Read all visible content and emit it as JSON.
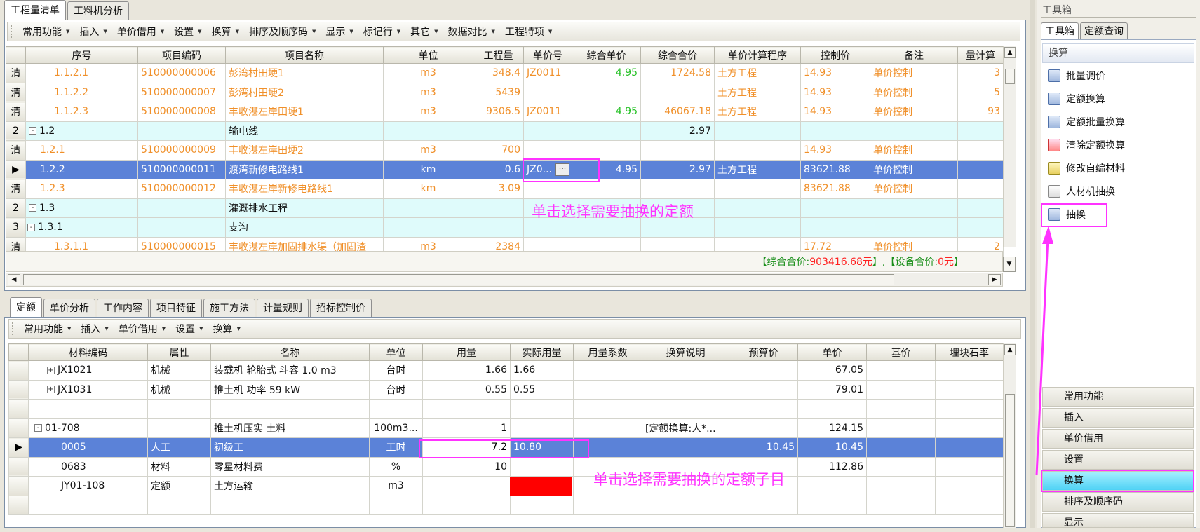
{
  "top_tabs": [
    "工程量清单",
    "工料机分析"
  ],
  "toolbar_top": [
    "常用功能",
    "插入",
    "单价借用",
    "设置",
    "换算",
    "排序及顺序码",
    "显示",
    "标记行",
    "其它",
    "数据对比",
    "工程特项"
  ],
  "upper_grid": {
    "headers": [
      "序号",
      "项目编码",
      "项目名称",
      "单位",
      "工程量",
      "单价号",
      "综合单价",
      "综合合价",
      "单价计算程序",
      "控制价",
      "备注",
      "量计算"
    ],
    "rows": [
      {
        "rh": "清",
        "seq": "1.1.2.1",
        "code": "510000000006",
        "name": "彭湾村田埂1",
        "unit": "m3",
        "qty": "348.4",
        "pno": "JZ0011",
        "up": "4.95",
        "tp": "1724.58",
        "prog": "土方工程",
        "ctrl": "14.93",
        "note": "单价控制",
        "calc": "3"
      },
      {
        "rh": "清",
        "seq": "1.1.2.2",
        "code": "510000000007",
        "name": "彭湾村田埂2",
        "unit": "m3",
        "qty": "5439",
        "pno": "",
        "up": "",
        "tp": "",
        "prog": "土方工程",
        "ctrl": "14.93",
        "note": "单价控制",
        "calc": "5"
      },
      {
        "rh": "清",
        "seq": "1.1.2.3",
        "code": "510000000008",
        "name": "丰收湛左岸田埂1",
        "unit": "m3",
        "qty": "9306.5",
        "pno": "JZ0011",
        "up": "4.95",
        "tp": "46067.18",
        "prog": "土方工程",
        "ctrl": "14.93",
        "note": "单价控制",
        "calc": "93"
      },
      {
        "rh": "2",
        "seq": "1.2",
        "code": "",
        "name": "输电线",
        "unit": "",
        "qty": "",
        "pno": "",
        "up": "",
        "tp": "2.97",
        "prog": "",
        "ctrl": "",
        "note": "",
        "calc": ""
      },
      {
        "rh": "清",
        "seq": "1.2.1",
        "code": "510000000009",
        "name": "丰收湛左岸田埂2",
        "unit": "m3",
        "qty": "700",
        "pno": "",
        "up": "",
        "tp": "",
        "prog": "",
        "ctrl": "14.93",
        "note": "单价控制",
        "calc": ""
      },
      {
        "rh": "▶",
        "seq": "1.2.2",
        "code": "510000000011",
        "name": "渡湾新修电路线1",
        "unit": "km",
        "qty": "0.6",
        "pno": "JZ0...",
        "up": "4.95",
        "tp": "2.97",
        "prog": "土方工程",
        "ctrl": "83621.88",
        "note": "单价控制",
        "calc": ""
      },
      {
        "rh": "清",
        "seq": "1.2.3",
        "code": "510000000012",
        "name": "丰收湛左岸新修电路线1",
        "unit": "km",
        "qty": "3.09",
        "pno": "",
        "up": "",
        "tp": "",
        "prog": "",
        "ctrl": "83621.88",
        "note": "单价控制",
        "calc": ""
      },
      {
        "rh": "2",
        "seq": "1.3",
        "code": "",
        "name": "灌溉排水工程",
        "unit": "",
        "qty": "",
        "pno": "",
        "up": "",
        "tp": "",
        "prog": "",
        "ctrl": "",
        "note": "",
        "calc": ""
      },
      {
        "rh": "3",
        "seq": "1.3.1",
        "code": "",
        "name": "支沟",
        "unit": "",
        "qty": "",
        "pno": "",
        "up": "",
        "tp": "",
        "prog": "",
        "ctrl": "",
        "note": "",
        "calc": ""
      },
      {
        "rh": "清",
        "seq": "1.3.1.1",
        "code": "510000000015",
        "name": "丰收湛左岸加固排水渠（加固渣",
        "unit": "m3",
        "qty": "2384",
        "pno": "",
        "up": "",
        "tp": "",
        "prog": "",
        "ctrl": "17.72",
        "note": "单价控制",
        "calc": "2"
      }
    ],
    "summary_prefix": "【综合合价:",
    "summary_total": "903416.68元",
    "summary_mid": "】,【设备合价:",
    "summary_equip": "0元",
    "summary_suffix": "】"
  },
  "annotation_upper": "单击选择需要抽换的定额",
  "annotation_lower": "单击选择需要抽换的定额子目",
  "bottom_tabs": [
    "定额",
    "单价分析",
    "工作内容",
    "项目特征",
    "施工方法",
    "计量规则",
    "招标控制价"
  ],
  "toolbar_bottom": [
    "常用功能",
    "插入",
    "单价借用",
    "设置",
    "换算"
  ],
  "lower_grid": {
    "headers": [
      "材料编码",
      "属性",
      "名称",
      "单位",
      "用量",
      "实际用量",
      "用量系数",
      "换算说明",
      "预算价",
      "单价",
      "基价",
      "埋块石率"
    ],
    "rows": [
      {
        "rh": "",
        "code": "JX1021",
        "tree": "+",
        "attr": "机械",
        "name": "装载机 轮胎式 斗容 1.0 m3",
        "unit": "台时",
        "qty": "1.66",
        "aqty": "1.66",
        "coef": "",
        "desc": "",
        "bp": "",
        "price": "67.05",
        "base": "",
        "rate": ""
      },
      {
        "rh": "",
        "code": "JX1031",
        "tree": "+",
        "attr": "机械",
        "name": "推土机 功率 59 kW",
        "unit": "台时",
        "qty": "0.55",
        "aqty": "0.55",
        "coef": "",
        "desc": "",
        "bp": "",
        "price": "79.01",
        "base": "",
        "rate": ""
      },
      {
        "rh": "",
        "code": "",
        "tree": "",
        "attr": "",
        "name": "",
        "unit": "",
        "qty": "",
        "aqty": "",
        "coef": "",
        "desc": "",
        "bp": "",
        "price": "",
        "base": "",
        "rate": ""
      },
      {
        "rh": "",
        "code": "01-708",
        "tree": "-",
        "attr": "",
        "name": "推土机压实 土料",
        "unit": "100m3...",
        "qty": "1",
        "aqty": "",
        "coef": "",
        "desc": "[定额换算:人*...",
        "bp": "",
        "price": "124.15",
        "base": "",
        "rate": ""
      },
      {
        "rh": "▶",
        "code": "0005",
        "tree": "",
        "attr": "人工",
        "name": "初级工",
        "unit": "工时",
        "qty": "7.2",
        "aqty": "10.80",
        "coef": "",
        "desc": "",
        "bp": "10.45",
        "price": "10.45",
        "base": "",
        "rate": ""
      },
      {
        "rh": "",
        "code": "0683",
        "tree": "",
        "attr": "材料",
        "name": "零星材料费",
        "unit": "%",
        "qty": "10",
        "aqty": "",
        "coef": "",
        "desc": "",
        "bp": "",
        "price": "112.86",
        "base": "",
        "rate": ""
      },
      {
        "rh": "",
        "code": "JY01-108",
        "tree": "",
        "attr": "定额",
        "name": "土方运输",
        "unit": "m3",
        "qty": "",
        "aqty": "",
        "coef": "",
        "desc": "",
        "bp": "",
        "price": "",
        "base": "",
        "rate": ""
      },
      {
        "rh": "",
        "code": "",
        "tree": "",
        "attr": "",
        "name": "",
        "unit": "",
        "qty": "",
        "aqty": "",
        "coef": "",
        "desc": "",
        "bp": "",
        "price": "",
        "base": "",
        "rate": ""
      }
    ]
  },
  "toolbox": {
    "title": "工具箱",
    "tabs": [
      "工具箱",
      "定额查询"
    ],
    "section": "换算",
    "items": [
      "批量调价",
      "定额换算",
      "定额批量换算",
      "清除定额换算",
      "修改自编材料",
      "人材机抽换",
      "抽换"
    ],
    "buttons": [
      "常用功能",
      "插入",
      "单价借用",
      "设置",
      "换算",
      "排序及顺序码",
      "显示"
    ]
  },
  "colors": {
    "orange": "#f0902a",
    "selection": "#5b82d8",
    "highlight": "#ff33ff",
    "cyan": "#dffbfb"
  }
}
